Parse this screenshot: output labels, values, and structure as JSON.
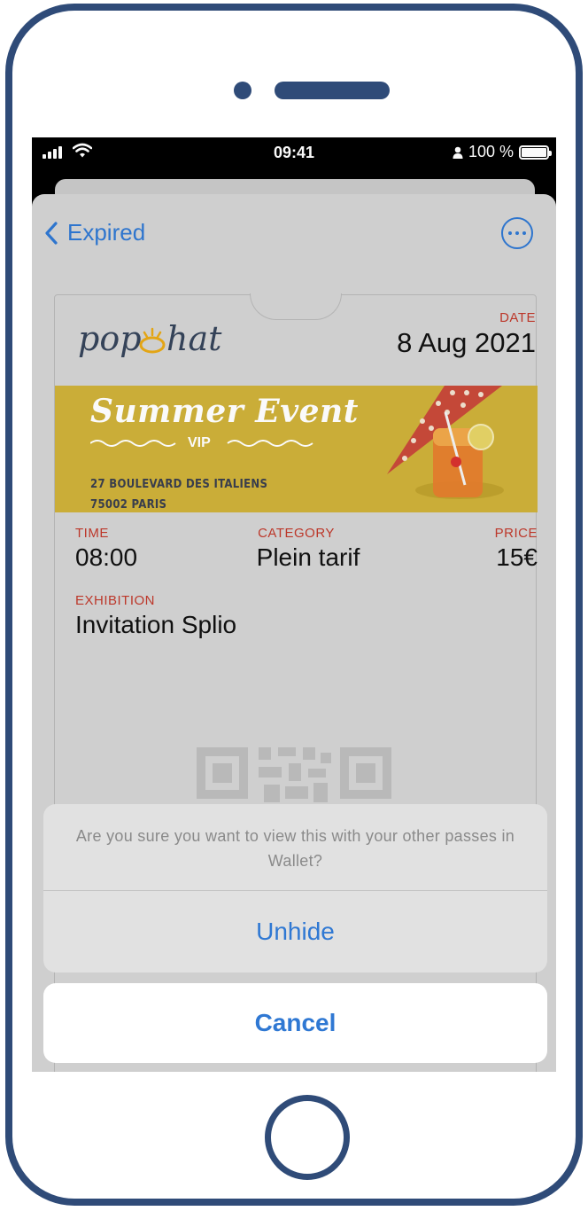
{
  "status_bar": {
    "time": "09:41",
    "battery": "100 %",
    "battery_level": 1.0
  },
  "nav": {
    "back_label": "Expired",
    "icons": [
      "chevron-left-icon",
      "more-icon"
    ]
  },
  "pass": {
    "brand_logo": "pop hat",
    "date_label": "DATE",
    "date_value": "8 Aug 2021",
    "banner": {
      "title": "Summer Event",
      "subtitle": "VIP",
      "address_line1": "27 BOULEVARD DES ITALIENS",
      "address_line2": "75002 PARIS"
    },
    "fields": [
      {
        "label": "TIME",
        "value": "08:00"
      },
      {
        "label": "CATEGORY",
        "value": "Plein tarif"
      },
      {
        "label": "PRICE",
        "value": "15€"
      }
    ],
    "exhibition": {
      "label": "EXHIBITION",
      "value": "Invitation Splio"
    }
  },
  "alert": {
    "message": "Are you sure you want to view this with your other passes in Wallet?",
    "action_label": "Unhide",
    "cancel_label": "Cancel"
  },
  "colors": {
    "frame": "#2f4b78",
    "accent": "#2f78d3",
    "field_label": "#c0392b",
    "banner": "#cfb13a"
  }
}
